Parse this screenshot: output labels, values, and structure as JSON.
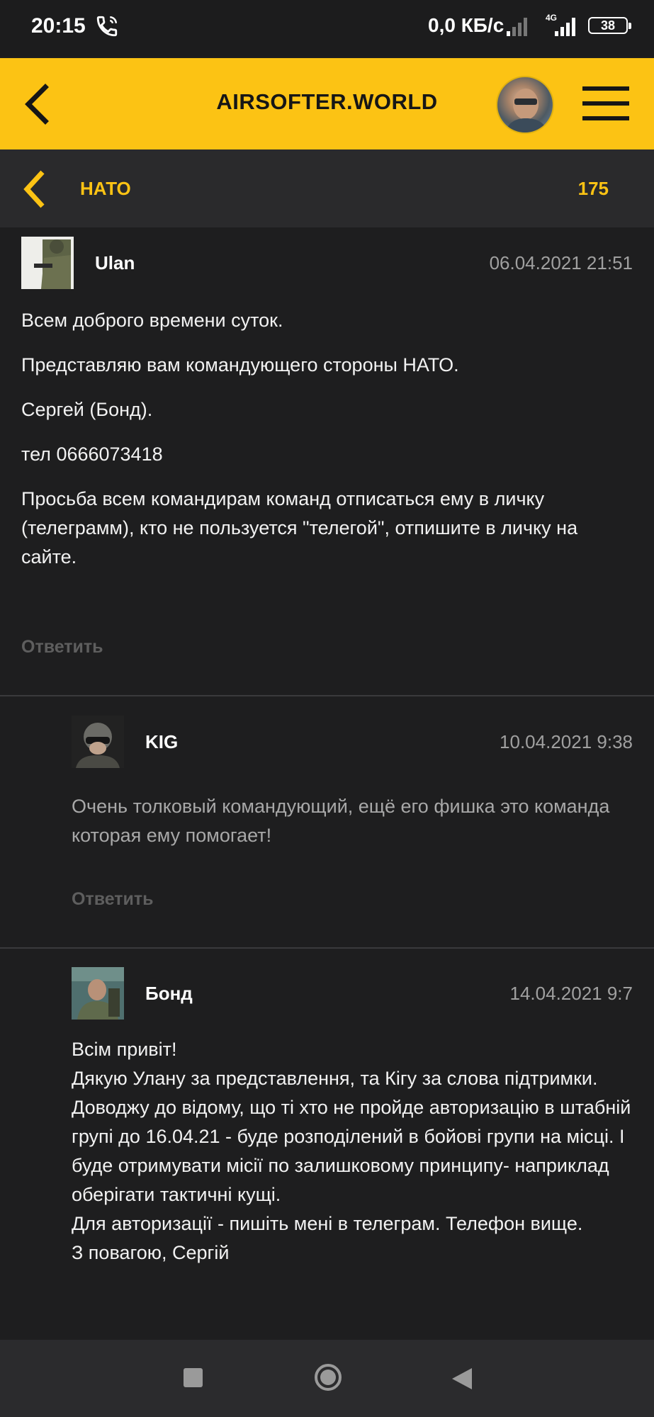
{
  "status_bar": {
    "time": "20:15",
    "network_speed": "0,0 КБ/с",
    "network_type": "4G",
    "battery": "38"
  },
  "header": {
    "site_title": "AIRSOFTER.WORLD",
    "accent_color": "#fcc314"
  },
  "topic": {
    "title": "НАТО",
    "count": "175"
  },
  "posts": [
    {
      "author": "Ulan",
      "date": "06.04.2021 21:51",
      "paragraphs": [
        "Всем доброго времени суток.",
        "Представляю вам командующего стороны НАТО.",
        "Сергей (Бонд).",
        "тел 0666073418",
        "Просьба всем командирам команд отписаться ему в личку (телеграмм), кто не пользуется \"телегой\", отпишите в личку на сайте."
      ],
      "reply_label": "Ответить"
    },
    {
      "author": "KIG",
      "date": "10.04.2021 9:38",
      "text": "Очень толковый командующий, ещё его фишка это команда которая ему помогает!",
      "reply_label": "Ответить"
    },
    {
      "author": "Бонд",
      "date": "14.04.2021 9:7",
      "lines": [
        "Всім привіт!",
        "Дякую Улану за представлення, та Кігу за слова підтримки.",
        "Доводжу до відому, що ті хто не пройде авторизацію в штабній групі до 16.04.21 - буде розподілений в бойові групи на місці. І буде отримувати місії по залишковому принципу- наприклад оберігати тактичні кущі.",
        "Для авторизації - пишіть мені в телеграм. Телефон вище.",
        "З повагою, Сергій"
      ]
    }
  ]
}
